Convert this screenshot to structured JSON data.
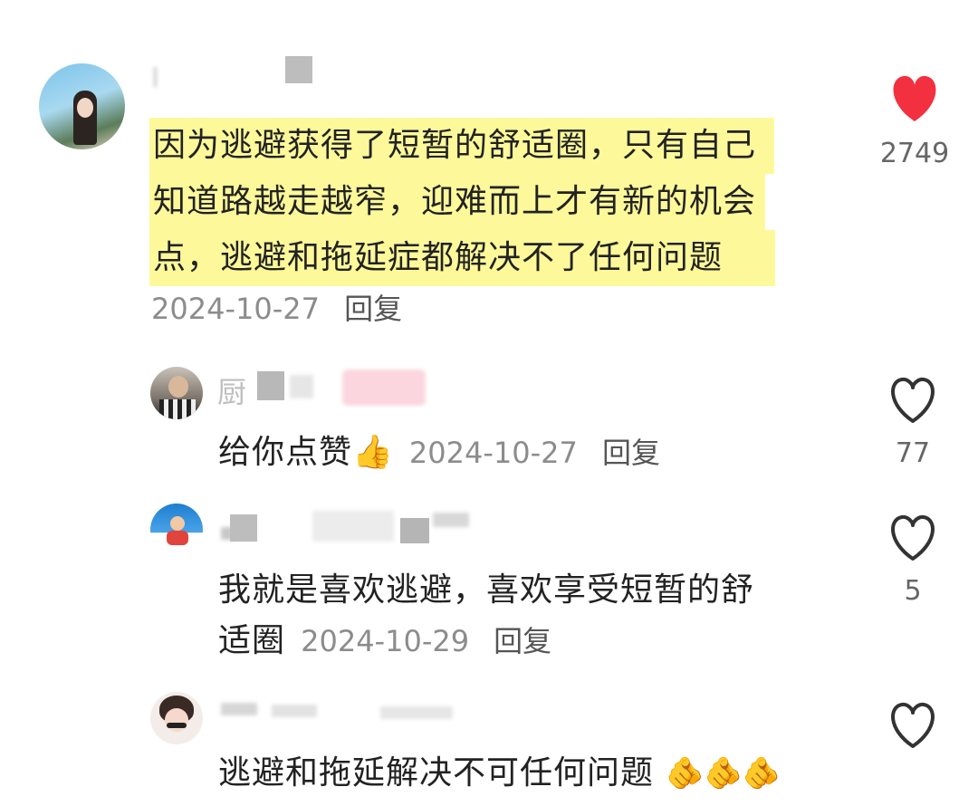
{
  "comments": [
    {
      "text_lines": [
        "因为逃避获得了短暂的舒适圈，只有自己",
        "知道路越走越窄，迎难而上才有新的机会",
        "点，逃避和拖延症都解决不了任何问题"
      ],
      "date": "2024-10-27",
      "reply": "回复",
      "likes": "2749",
      "liked": true,
      "heart_color": "#f2303f"
    }
  ],
  "replies": [
    {
      "text": "给你点赞👍",
      "date": "2024-10-27",
      "reply": "回复",
      "likes": "77",
      "partial_name": "厨"
    },
    {
      "text_line1": "我就是喜欢逃避，喜欢享受短暂的舒",
      "text_line2": "适圈",
      "date": "2024-10-29",
      "reply": "回复",
      "likes": "5"
    },
    {
      "text": "逃避和拖延解决不可任何问题",
      "emoji": "🫵🫵🫵"
    }
  ]
}
